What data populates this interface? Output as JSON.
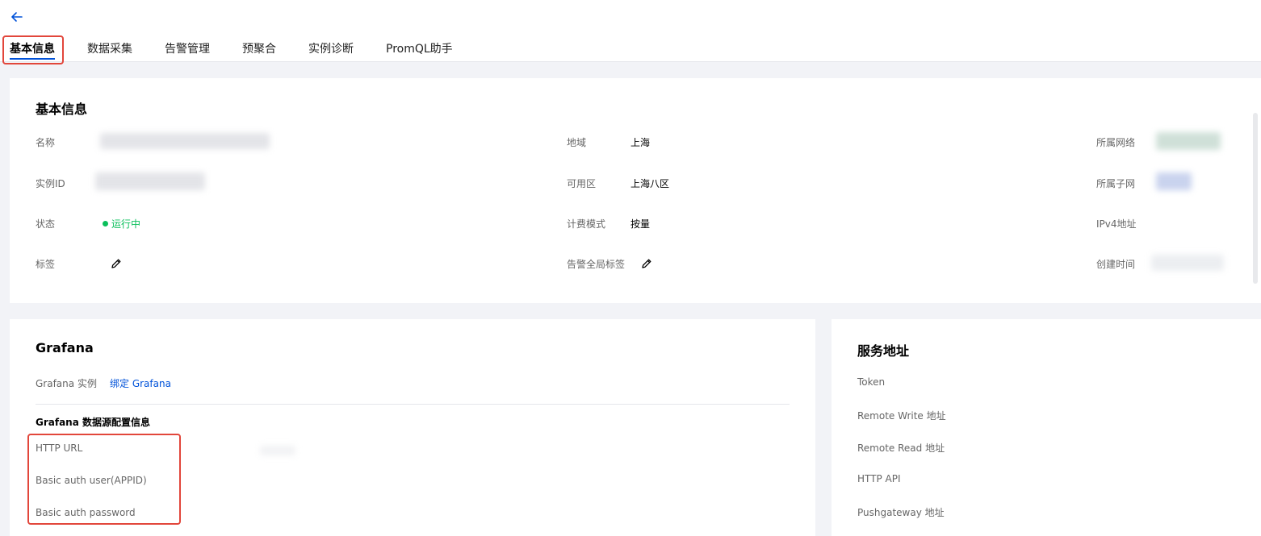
{
  "header": {
    "back_label": "←",
    "tabs": [
      {
        "label": "基本信息",
        "active": true
      },
      {
        "label": "数据采集",
        "active": false
      },
      {
        "label": "告警管理",
        "active": false
      },
      {
        "label": "预聚合",
        "active": false
      },
      {
        "label": "实例诊断",
        "active": false
      },
      {
        "label": "PromQL助手",
        "active": false
      }
    ]
  },
  "basic_info": {
    "title": "基本信息",
    "name_label": "名称",
    "instance_id_label": "实例ID",
    "status_label": "状态",
    "status_value": "运行中",
    "tags_label": "标签",
    "region_label": "地域",
    "region_value": "上海",
    "zone_label": "可用区",
    "zone_value": "上海八区",
    "billing_label": "计费模式",
    "billing_value": "按量",
    "alert_tags_label": "告警全局标签",
    "vpc_label": "所属网络",
    "subnet_label": "所属子网",
    "ipv4_label": "IPv4地址",
    "created_label": "创建时间"
  },
  "grafana": {
    "title": "Grafana",
    "instance_label": "Grafana 实例",
    "bind_link": "绑定 Grafana",
    "datasource_title": "Grafana 数据源配置信息",
    "http_url_label": "HTTP URL",
    "basic_user_label": "Basic auth user(APPID)",
    "basic_password_label": "Basic auth password"
  },
  "service": {
    "title": "服务地址",
    "token_label": "Token",
    "remote_write_label": "Remote Write 地址",
    "remote_read_label": "Remote Read 地址",
    "http_api_label": "HTTP API",
    "pushgateway_label": "Pushgateway 地址"
  },
  "colors": {
    "accent": "#0052d9",
    "running": "#0abf5b",
    "highlight": "#e2463b",
    "background": "#f2f3f7"
  }
}
